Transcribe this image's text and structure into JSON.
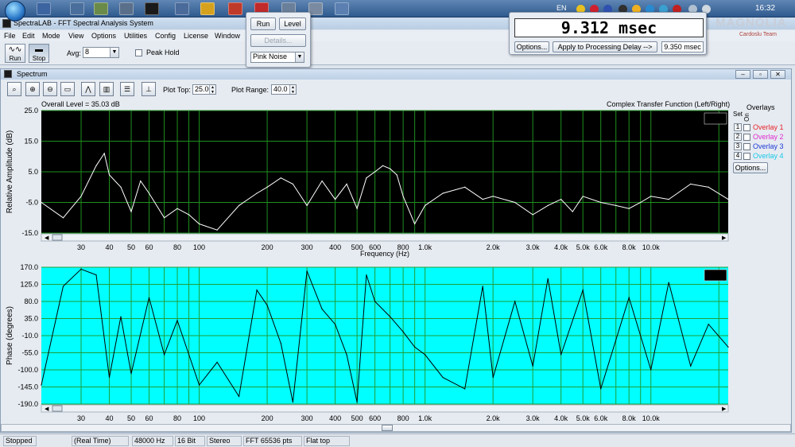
{
  "taskbar": {
    "language": "EN",
    "clock": "16:32",
    "brand_logo": "MAGNOLIA",
    "brand_sub": "Cardoslu Team"
  },
  "app": {
    "title": "SpectraLAB - FFT Spectral Analysis System"
  },
  "menu": [
    "File",
    "Edit",
    "Mode",
    "View",
    "Options",
    "Utilities",
    "Config",
    "License",
    "Window"
  ],
  "toolbar": {
    "run_label": "Run",
    "stop_label": "Stop",
    "avg_label": "Avg:",
    "avg_value": "8",
    "peak_hold_label": "Peak Hold"
  },
  "generator": {
    "run_label": "Run",
    "level_label": "Level",
    "details_label": "Details...",
    "signal_value": "Pink Noise"
  },
  "delay": {
    "display": "9.312 msec",
    "options_label": "Options...",
    "apply_label": "Apply to Processing Delay -->",
    "applied_value": "9.350 msec"
  },
  "spectrum": {
    "window_title": "Spectrum",
    "plot_top_label": "Plot Top:",
    "plot_top_value": "25.00",
    "plot_range_label": "Plot Range:",
    "plot_range_value": "40.0",
    "overall_level": "Overall Level = 35.03 dB",
    "transfer_label": "Complex Transfer Function (Left/Right)",
    "overlays_title": "Overlays",
    "set_label": "Set",
    "on_label": "On",
    "overlays": [
      {
        "num": "1",
        "label": "Overlay 1",
        "color": "#e8232a"
      },
      {
        "num": "2",
        "label": "Overlay 2",
        "color": "#e02ad0"
      },
      {
        "num": "3",
        "label": "Overlay 3",
        "color": "#1f3ad6"
      },
      {
        "num": "4",
        "label": "Overlay 4",
        "color": "#18c8e8"
      }
    ],
    "options_label": "Options..."
  },
  "amplitude_plot": {
    "ylabel": "Relative Amplitude (dB)",
    "xlabel": "Frequency (Hz)",
    "y_ticks": [
      "25.0",
      "15.0",
      "5.0",
      "-5.0",
      "-15.0"
    ],
    "background": "#000000",
    "grid_color": "#1e8f1e",
    "trace_color": "#ffffff"
  },
  "phase_plot": {
    "ylabel": "Phase (degrees)",
    "y_ticks": [
      "170.0",
      "125.0",
      "80.0",
      "35.0",
      "-10.0",
      "-55.0",
      "-100.0",
      "-145.0",
      "-190.0"
    ],
    "background": "#00ffff",
    "grid_color": "#1e9e3a",
    "trace_color": "#000000"
  },
  "x_ticks": [
    "30",
    "40",
    "50",
    "60",
    "80",
    "100",
    "200",
    "300",
    "400",
    "500",
    "600",
    "800",
    "1.0k",
    "2.0k",
    "3.0k",
    "4.0k",
    "5.0k",
    "6.0k",
    "8.0k",
    "10.0k"
  ],
  "status": {
    "state": "Stopped",
    "mode": "(Real Time)",
    "rate": "48000 Hz",
    "bits": "16 Bit",
    "channels": "Stereo",
    "fft": "FFT 65536 pts",
    "window": "Flat top"
  },
  "chart_data": [
    {
      "type": "line",
      "title": "Complex Transfer Function (Left/Right)",
      "xlabel": "Frequency (Hz)",
      "ylabel": "Relative Amplitude (dB)",
      "xscale": "log",
      "xlim": [
        20,
        22000
      ],
      "ylim": [
        -15,
        25
      ],
      "grid": true,
      "x": [
        20,
        25,
        30,
        35,
        38,
        40,
        45,
        50,
        55,
        60,
        70,
        80,
        90,
        100,
        120,
        150,
        180,
        200,
        230,
        260,
        300,
        350,
        400,
        450,
        500,
        550,
        600,
        650,
        700,
        750,
        800,
        900,
        1000,
        1200,
        1500,
        1800,
        2000,
        2500,
        3000,
        3500,
        4000,
        4500,
        5000,
        6000,
        7000,
        8000,
        9000,
        10000,
        12000,
        15000,
        18000,
        22000
      ],
      "values": [
        -5,
        -10,
        -3,
        7,
        11,
        4,
        0,
        -8,
        2,
        -2,
        -10,
        -7,
        -9,
        -12,
        -14,
        -6,
        -2,
        0,
        3,
        1,
        -6,
        2,
        -4,
        1,
        -7,
        3,
        5,
        7,
        6,
        4,
        -3,
        -12,
        -6,
        -2,
        0,
        -4,
        -3,
        -5,
        -9,
        -6,
        -4,
        -8,
        -3,
        -5,
        -6,
        -7,
        -5,
        -3,
        -4,
        1,
        0,
        -4
      ]
    },
    {
      "type": "line",
      "xlabel": "Frequency (Hz)",
      "ylabel": "Phase (degrees)",
      "xscale": "log",
      "xlim": [
        20,
        22000
      ],
      "ylim": [
        -190,
        170
      ],
      "grid": true,
      "x": [
        20,
        25,
        30,
        35,
        40,
        45,
        50,
        60,
        70,
        80,
        100,
        120,
        150,
        180,
        200,
        230,
        260,
        300,
        350,
        400,
        450,
        500,
        550,
        600,
        700,
        800,
        900,
        1000,
        1200,
        1500,
        1800,
        2000,
        2500,
        3000,
        3500,
        4000,
        5000,
        6000,
        8000,
        10000,
        12000,
        15000,
        18000,
        22000
      ],
      "values": [
        -140,
        120,
        165,
        150,
        -120,
        40,
        -110,
        90,
        -60,
        30,
        -140,
        -80,
        -170,
        110,
        70,
        -30,
        -185,
        160,
        60,
        20,
        -60,
        -185,
        150,
        80,
        40,
        0,
        -40,
        -60,
        -120,
        -150,
        120,
        -120,
        80,
        -90,
        140,
        -60,
        110,
        -150,
        90,
        -100,
        130,
        -90,
        20,
        -40
      ]
    }
  ]
}
